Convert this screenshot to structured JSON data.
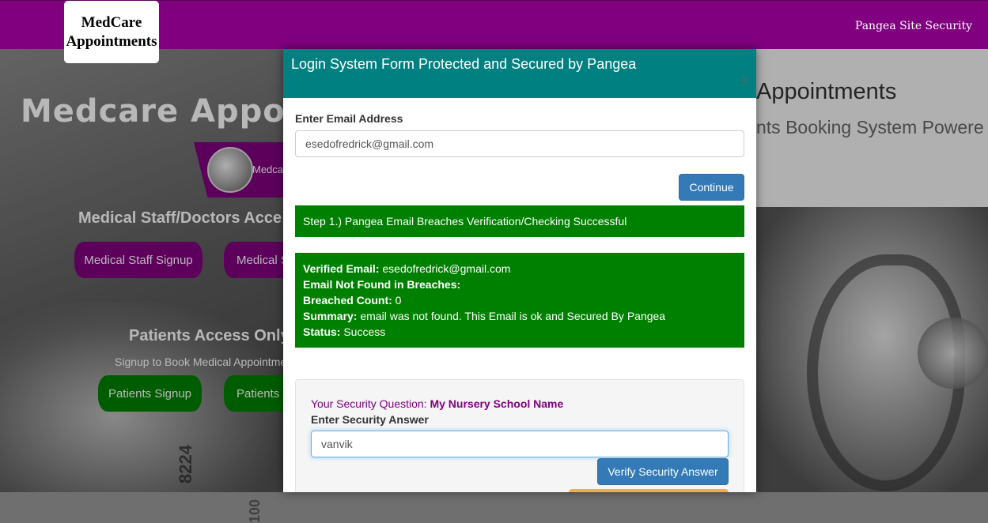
{
  "navbar": {
    "brand_line1": "MedCare",
    "brand_line2": "Appointments",
    "right_link": "Pangea Site Security"
  },
  "hero": {
    "title": "Medcare Appointm",
    "title_right": "Appointments",
    "subtitle_right": "nts Booking System Powere",
    "badge_text": "Medca",
    "staff_heading": "Medical Staff/Doctors Acce",
    "staff_signup": "Medical Staff Signup",
    "staff_login": "Medical S",
    "patients_heading": "Patients Access Only",
    "patients_sub": "Signup to Book Medical Appointme",
    "patients_signup": "Patients Signup",
    "patients_login": "Patients L",
    "bg_number": "8224",
    "bg_number2": "100"
  },
  "modal": {
    "title": "Login System Form Protected and Secured by Pangea",
    "close_label": "×",
    "email_label": "Enter Email Address",
    "email_value": "esedofredrick@gmail.com",
    "continue_label": "Continue",
    "step1_message": "Step 1.) Pangea Email Breaches Verification/Checking Successful",
    "result": {
      "verified_email_label": "Verified Email:",
      "verified_email_value": " esedofredrick@gmail.com",
      "not_found_label": "Email Not Found in Breaches:",
      "breached_count_label": "Breached Count:",
      "breached_count_value": " 0",
      "summary_label": "Summary:",
      "summary_value": " email was not found. This Email is ok and Secured By Pangea",
      "status_label": "Status:",
      "status_value": " Success"
    },
    "security": {
      "question_prefix": "Your Security Question: ",
      "question": "My Nursery School Name",
      "answer_label": "Enter Security Answer",
      "answer_value": "vanvik",
      "verify_label": "Verify Security Answer"
    }
  },
  "colors": {
    "navbar": "#800080",
    "modal_header": "#008080",
    "success": "#008000",
    "primary": "#337ab7"
  }
}
